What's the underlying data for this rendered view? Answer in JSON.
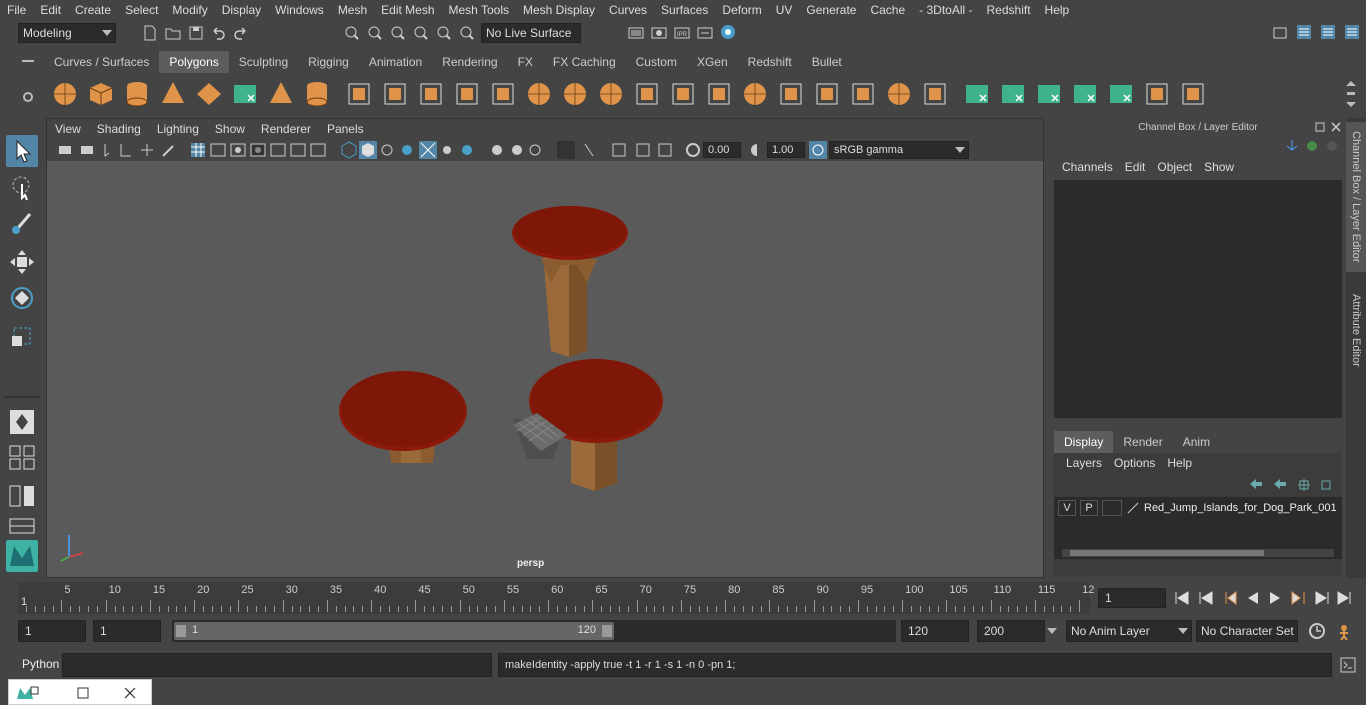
{
  "menubar": {
    "items": [
      "File",
      "Edit",
      "Create",
      "Select",
      "Modify",
      "Display",
      "Windows",
      "Mesh",
      "Edit Mesh",
      "Mesh Tools",
      "Mesh Display",
      "Curves",
      "Surfaces",
      "Deform",
      "UV",
      "Generate",
      "Cache",
      "- 3DtoAll -",
      "Redshift",
      "Help"
    ]
  },
  "statusline": {
    "mode": "Modeling",
    "live_surface": "No Live Surface"
  },
  "shelf": {
    "tabs": [
      "Curves / Surfaces",
      "Polygons",
      "Sculpting",
      "Rigging",
      "Animation",
      "Rendering",
      "FX",
      "FX Caching",
      "Custom",
      "XGen",
      "Redshift",
      "Bullet"
    ],
    "active_tab": "Polygons"
  },
  "viewport": {
    "menu": [
      "View",
      "Shading",
      "Lighting",
      "Show",
      "Renderer",
      "Panels"
    ],
    "exposure": "0.00",
    "gamma": "1.00",
    "color_space": "sRGB gamma",
    "camera_label": "persp"
  },
  "channelbox": {
    "title": "Channel Box / Layer Editor",
    "menu": [
      "Channels",
      "Edit",
      "Object",
      "Show"
    ],
    "tabs": [
      "Display",
      "Render",
      "Anim"
    ],
    "active_tab": "Display",
    "layer_menu": [
      "Layers",
      "Options",
      "Help"
    ],
    "layer": {
      "v": "V",
      "p": "P",
      "name": "Red_Jump_Islands_for_Dog_Park_001"
    }
  },
  "side_tabs": [
    "Channel Box / Layer Editor",
    "Attribute Editor"
  ],
  "timeline": {
    "ticks": [
      "5",
      "10",
      "15",
      "20",
      "25",
      "30",
      "35",
      "40",
      "45",
      "50",
      "55",
      "60",
      "65",
      "70",
      "75",
      "80",
      "85",
      "90",
      "95",
      "100",
      "105",
      "110",
      "115",
      "12"
    ],
    "start_mark": "1",
    "current_frame": "1"
  },
  "range": {
    "start": "1",
    "playback_start": "1",
    "slider_start": "1",
    "slider_end": "120",
    "playback_end": "120",
    "end": "200",
    "anim_layer": "No Anim Layer",
    "character_set": "No Character Set"
  },
  "cmdline": {
    "lang": "Python",
    "output": "makeIdentity -apply true -t 1 -r 1 -s 1 -n 0 -pn 1;"
  },
  "colors": {
    "ui_bg": "#444444",
    "viewport_bg": "#5a5a5a",
    "accent": "#5285a6",
    "shelf_orange": "#e0944a",
    "shelf_green": "#3fb389",
    "cap_red": "#8b1a0a",
    "wood": "#9a6a3a"
  }
}
